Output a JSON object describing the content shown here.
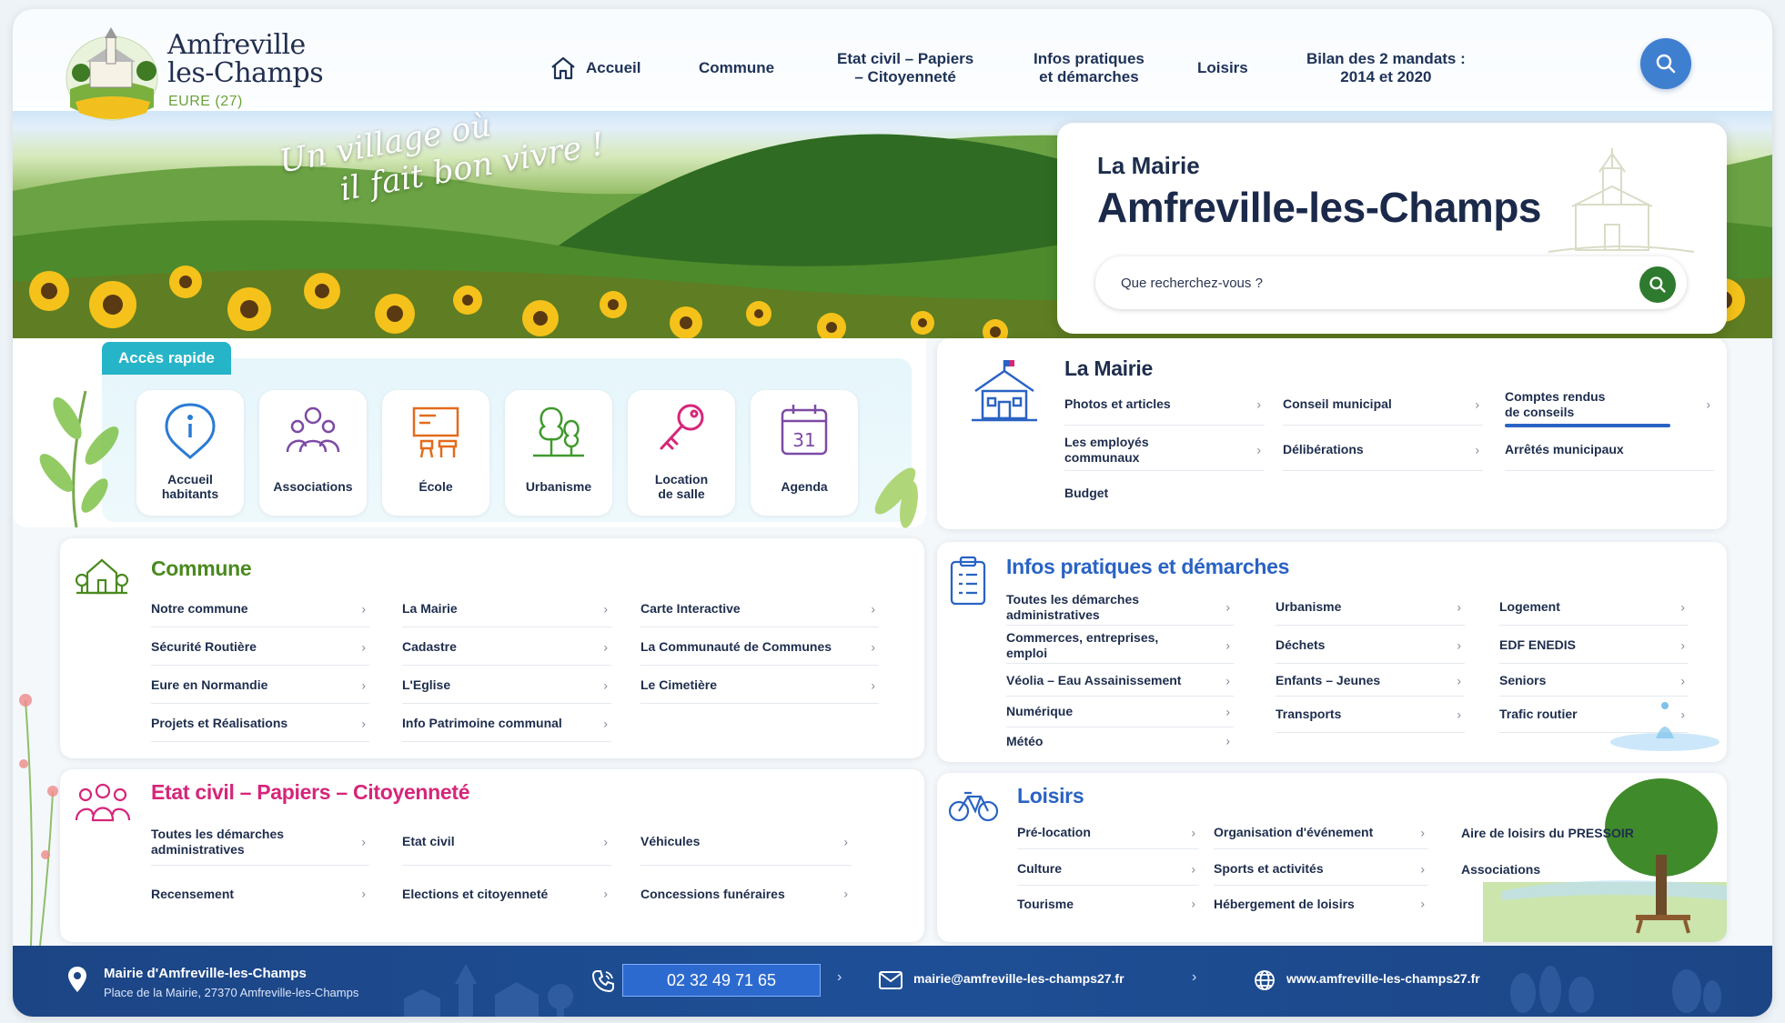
{
  "brand": {
    "name": "Amfreville\nles-Champs",
    "subtitle": "EURE (27)"
  },
  "nav": {
    "home": "Accueil",
    "commune": "Commune",
    "etat_civil": "Etat civil – Papiers\n– Citoyenneté",
    "infos": "Infos pratiques\net démarches",
    "loisirs": "Loisirs",
    "bilan": "Bilan des 2 mandats :\n2014 et 2020"
  },
  "hero": {
    "slogan_line1": "Un village où",
    "slogan_line2": "il fait bon vivre !",
    "card_label": "La Mairie",
    "card_title": "Amfreville-les-Champs",
    "search_placeholder": "Que recherchez-vous ?"
  },
  "quick_access": {
    "title": "Accès rapide",
    "items": [
      {
        "label": "Accueil\nhabitants",
        "icon": "info-icon"
      },
      {
        "label": "Associations",
        "icon": "people-group-icon"
      },
      {
        "label": "École",
        "icon": "school-board-icon"
      },
      {
        "label": "Urbanisme",
        "icon": "trees-house-icon"
      },
      {
        "label": "Location\nde salle",
        "icon": "key-icon"
      },
      {
        "label": "Agenda",
        "icon": "calendar-icon",
        "calendar_day": "31"
      }
    ]
  },
  "mairie": {
    "title": "La Mairie",
    "links": [
      "Photos et articles",
      "Conseil municipal",
      "Comptes rendus\nde conseils",
      "Les employés\ncommunaux",
      "Délibérations",
      "Arrêtés municipaux",
      "Budget"
    ]
  },
  "commune": {
    "title": "Commune",
    "col1": [
      "Notre commune",
      "Sécurité Routière",
      "Eure en Normandie",
      "Projets et Réalisations"
    ],
    "col2": [
      "La Mairie",
      "Cadastre",
      "L'Eglise",
      "Info Patrimoine communal"
    ],
    "col3": [
      "Carte Interactive",
      "La Communauté de Communes",
      "Le Cimetière"
    ]
  },
  "infos": {
    "title": "Infos pratiques et démarches",
    "col1": [
      "Toutes les démarches\nadministratives",
      "Commerces, entreprises,\nemploi",
      "Véolia – Eau Assainissement",
      "Numérique",
      "Météo"
    ],
    "col2": [
      "Urbanisme",
      "Déchets",
      "Enfants – Jeunes",
      "Transports"
    ],
    "col3": [
      "Logement",
      "EDF ENEDIS",
      "Seniors",
      "Trafic routier"
    ]
  },
  "etat_civil": {
    "title": "Etat civil – Papiers – Citoyenneté",
    "col1": [
      "Toutes les démarches\nadministratives",
      "Recensement"
    ],
    "col2": [
      "Etat civil",
      "Elections et citoyenneté"
    ],
    "col3": [
      "Véhicules",
      "Concessions funéraires"
    ]
  },
  "loisirs": {
    "title": "Loisirs",
    "col1": [
      "Pré-location",
      "Culture",
      "Tourisme"
    ],
    "col2": [
      "Organisation d'événement",
      "Sports et activités",
      "Hébergement de loisirs"
    ],
    "col3": [
      "Aire de loisirs du PRESSOIR",
      "Associations"
    ]
  },
  "footer": {
    "mairie_name": "Mairie d'Amfreville-les-Champs",
    "address": "Place de la Mairie, 27370 Amfreville-les-Champs",
    "phone": "02 32 49 71 65",
    "email": "mairie@amfreville-les-champs27.fr",
    "website": "www.amfreville-les-champs27.fr"
  },
  "colors": {
    "nav_blue": "#3f7fd0",
    "commune_green": "#4a8a1f",
    "infos_blue": "#2a63c4",
    "etat_civil_pink": "#d6267a",
    "loisirs_blue": "#2a63c4",
    "footer_navy": "#1c4585",
    "quick_access_teal": "#26b4c8"
  }
}
